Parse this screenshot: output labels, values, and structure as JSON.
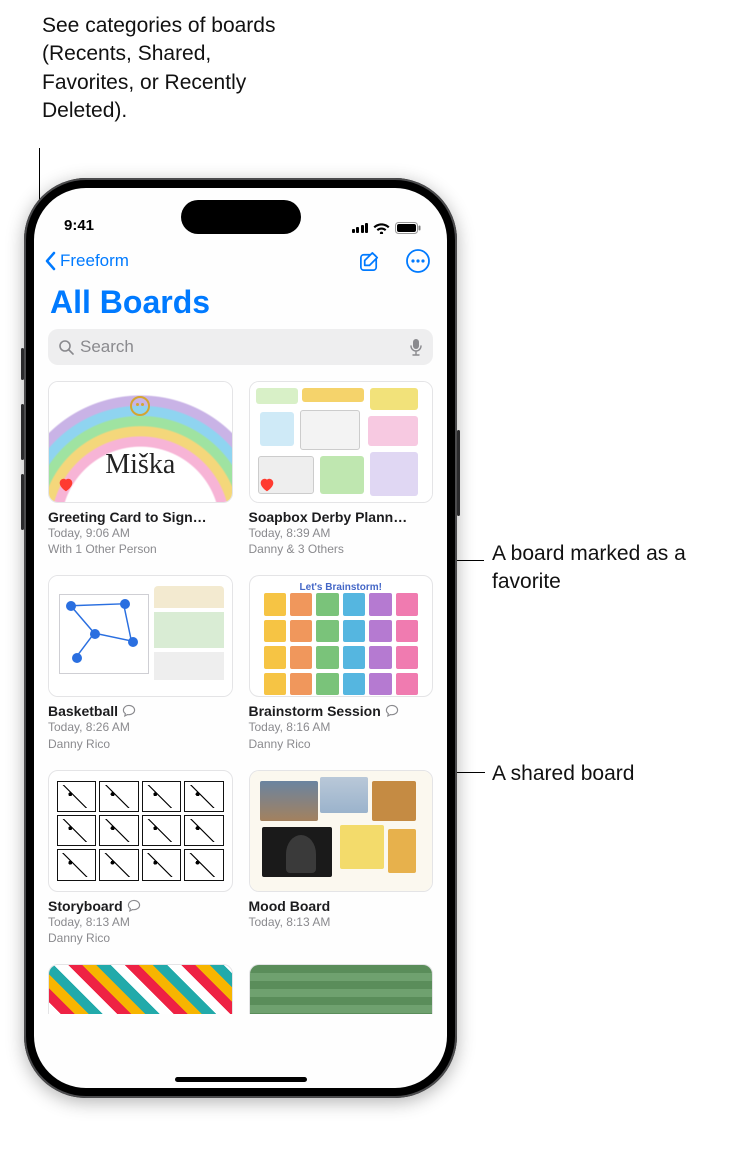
{
  "callouts": {
    "categories": "See categories of boards (Recents, Shared, Favorites, or Recently Deleted).",
    "favorite": "A board marked as a favorite",
    "shared": "A shared board"
  },
  "statusBar": {
    "time": "9:41"
  },
  "nav": {
    "backLabel": "Freeform",
    "title": "All Boards"
  },
  "search": {
    "placeholder": "Search"
  },
  "boards": [
    {
      "title": "Greeting Card to Sign…",
      "time": "Today, 9:06 AM",
      "sub": "With 1 Other Person",
      "favorite": true,
      "shared": false,
      "thumbText": "Miška"
    },
    {
      "title": "Soapbox Derby Plann…",
      "time": "Today, 8:39 AM",
      "sub": "Danny & 3 Others",
      "favorite": true,
      "shared": false
    },
    {
      "title": "Basketball",
      "time": "Today, 8:26 AM",
      "sub": "Danny Rico",
      "favorite": false,
      "shared": true
    },
    {
      "title": "Brainstorm Session",
      "time": "Today, 8:16 AM",
      "sub": "Danny Rico",
      "favorite": false,
      "shared": true,
      "thumbText": "Let's Brainstorm!"
    },
    {
      "title": "Storyboard",
      "time": "Today, 8:13 AM",
      "sub": "Danny Rico",
      "favorite": false,
      "shared": true
    },
    {
      "title": "Mood Board",
      "time": "Today, 8:13 AM",
      "sub": "",
      "favorite": false,
      "shared": false
    }
  ],
  "stickyColors": [
    "#f6c444",
    "#f0975c",
    "#7ac37a",
    "#55b6e0",
    "#b57ad1",
    "#f07bb0"
  ]
}
